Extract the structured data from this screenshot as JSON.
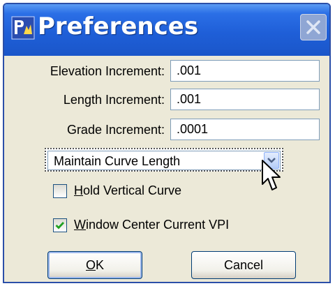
{
  "window": {
    "title": "Preferences"
  },
  "fields": [
    {
      "label": "Elevation Increment:",
      "value": ".001"
    },
    {
      "label": "Length Increment:",
      "value": ".001"
    },
    {
      "label": "Grade Increment:",
      "value": ".0001"
    }
  ],
  "curve_mode": {
    "selected": "Maintain Curve Length"
  },
  "checkboxes": [
    {
      "accel": "H",
      "rest": "old Vertical Curve",
      "checked": false
    },
    {
      "accel": "W",
      "rest": "indow Center Current VPI",
      "checked": true
    }
  ],
  "buttons": {
    "ok_accel": "O",
    "ok_rest": "K",
    "cancel": "Cancel"
  },
  "icons": {
    "app": "app-icon",
    "close": "close-icon",
    "dropdown": "chevron-down-icon",
    "pointer": "mouse-pointer-icon",
    "check": "checkmark-icon"
  }
}
